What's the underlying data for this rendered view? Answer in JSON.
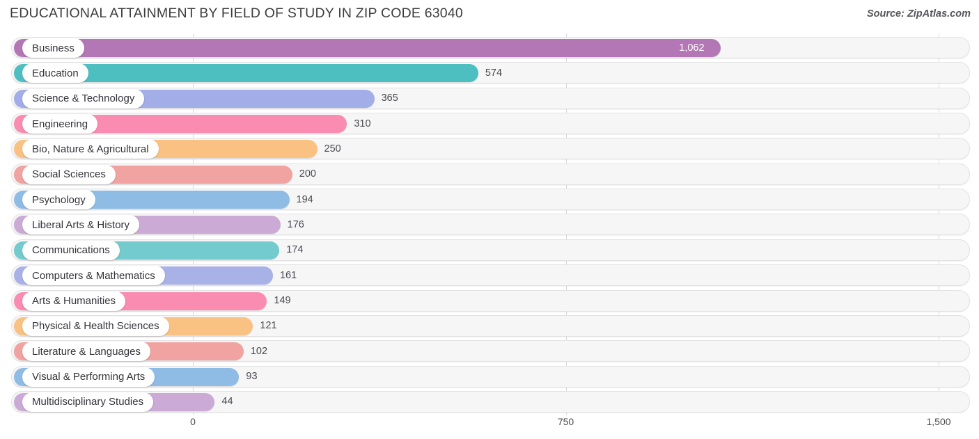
{
  "header": {
    "title": "EDUCATIONAL ATTAINMENT BY FIELD OF STUDY IN ZIP CODE 63040",
    "source": "Source: ZipAtlas.com"
  },
  "chart_data": {
    "type": "bar",
    "orientation": "horizontal",
    "title": "EDUCATIONAL ATTAINMENT BY FIELD OF STUDY IN ZIP CODE 63040",
    "xlabel": "",
    "ylabel": "",
    "xlim": [
      0,
      1500
    ],
    "grid": true,
    "legend": "none",
    "xticks": [
      "0",
      "750",
      "1,500"
    ],
    "xtick_values": [
      0,
      750,
      1500
    ],
    "categories": [
      "Business",
      "Education",
      "Science & Technology",
      "Engineering",
      "Bio, Nature & Agricultural",
      "Social Sciences",
      "Psychology",
      "Liberal Arts & History",
      "Communications",
      "Computers & Mathematics",
      "Arts & Humanities",
      "Physical & Health Sciences",
      "Literature & Languages",
      "Visual & Performing Arts",
      "Multidisciplinary Studies"
    ],
    "values": [
      1062,
      574,
      365,
      310,
      250,
      200,
      194,
      176,
      174,
      161,
      149,
      121,
      102,
      93,
      44
    ],
    "value_labels": [
      "1,062",
      "574",
      "365",
      "310",
      "250",
      "200",
      "194",
      "176",
      "174",
      "161",
      "149",
      "121",
      "102",
      "93",
      "44"
    ],
    "colors": [
      "#b277b4",
      "#4ebfc1",
      "#a3aee8",
      "#f98cb0",
      "#fac282",
      "#f0a3a0",
      "#8fbce5",
      "#cbabd6",
      "#73cbcd",
      "#a8b2e6",
      "#f98cb0",
      "#fac282",
      "#f0a3a0",
      "#8fbce5",
      "#cbabd6"
    ]
  },
  "colors": {
    "track_fill": "#f6f6f7",
    "track_border": "#e2e2e4",
    "gridline": "#d8d8dc",
    "text": "#3c3c3c",
    "value_text_outside": "#4a4a4f",
    "value_text_inside": "#ffffff"
  }
}
